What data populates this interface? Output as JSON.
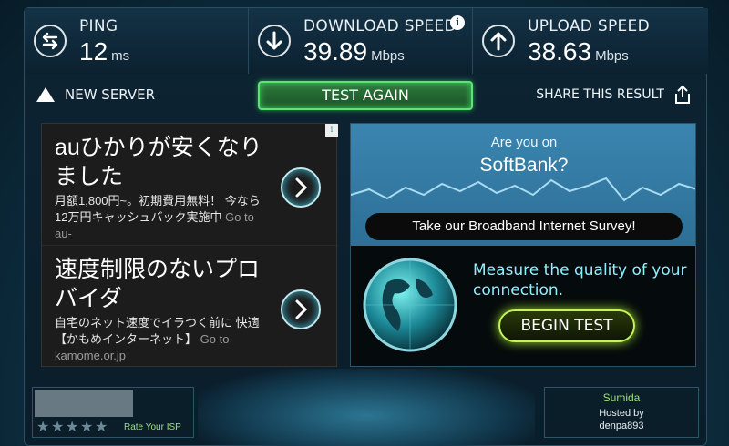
{
  "stats": {
    "ping": {
      "label": "PING",
      "value": "12",
      "unit": "ms",
      "icon": "ping-arrows-icon"
    },
    "download": {
      "label": "DOWNLOAD SPEED",
      "value": "39.89",
      "unit": "Mbps",
      "icon": "download-arrow-icon"
    },
    "upload": {
      "label": "UPLOAD SPEED",
      "value": "38.63",
      "unit": "Mbps",
      "icon": "upload-arrow-icon"
    },
    "info": "i"
  },
  "actions": {
    "new_server": "NEW SERVER",
    "test_again": "TEST AGAIN",
    "share": "SHARE THIS RESULT"
  },
  "ads": [
    {
      "title": "auひかりが安くなりました",
      "desc": "月額1,800円~。初期費用無料！ 今なら12万円キャッシュバック実施中",
      "goto": "Go to au-"
    },
    {
      "title": "速度制限のないプロバイダ",
      "desc": "自宅のネット速度でイラつく前に 快適【かもめインターネット】",
      "goto": "Go to kamome.or.jp"
    }
  ],
  "ad_badge": "i",
  "survey": {
    "question_line1": "Are you on",
    "question_line2": "SoftBank?",
    "banner": "Take our Broadband Internet Survey!",
    "measure": "Measure the quality of your connection.",
    "begin": "BEGIN TEST"
  },
  "isp": {
    "rate_label": "Rate Your ISP",
    "stars": 5
  },
  "host": {
    "city": "Sumida",
    "hosted_by": "Hosted by",
    "name": "denpa893"
  },
  "colors": {
    "accent_green": "#5ee37a",
    "cyan": "#8ff0ff",
    "lime": "#c6f35a"
  }
}
